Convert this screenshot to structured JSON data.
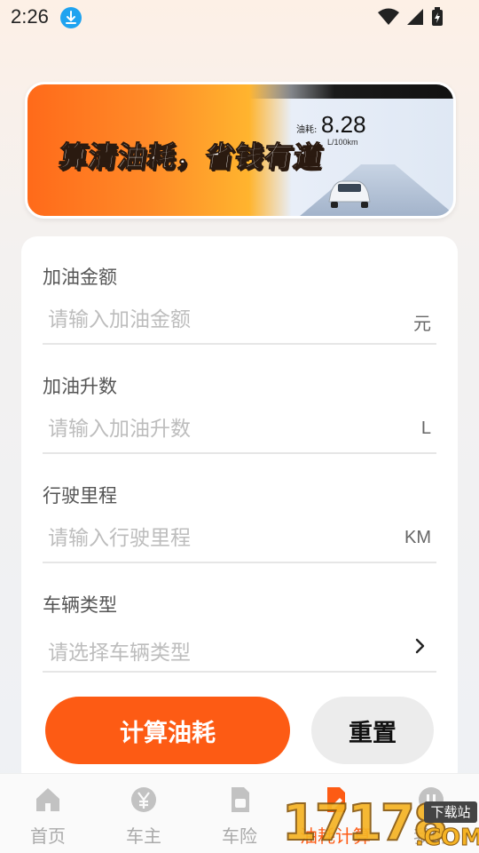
{
  "status_bar": {
    "time": "2:26"
  },
  "banner": {
    "slogan": "算清油耗，省钱有道",
    "fuel_label": "油耗:",
    "fuel_value": "8.28",
    "fuel_unit": "L/100km"
  },
  "form": {
    "fields": [
      {
        "label": "加油金额",
        "placeholder": "请输入加油金额",
        "unit": "元"
      },
      {
        "label": "加油升数",
        "placeholder": "请输入加油升数",
        "unit": "L"
      },
      {
        "label": "行驶里程",
        "placeholder": "请输入行驶里程",
        "unit": "KM"
      },
      {
        "label": "车辆类型",
        "placeholder": "请选择车辆类型"
      }
    ],
    "calculate_label": "计算油耗",
    "reset_label": "重置"
  },
  "nav": {
    "items": [
      {
        "label": "首页",
        "icon": "home-icon"
      },
      {
        "label": "车主",
        "icon": "yuan-coin-icon"
      },
      {
        "label": "车险",
        "icon": "insurance-doc-icon"
      },
      {
        "label": "油耗计算",
        "icon": "fuel-edit-icon",
        "active": true
      },
      {
        "label": "我的",
        "icon": "profile-icon"
      }
    ]
  },
  "watermark": {
    "digits": "17178",
    "badge": "下载站",
    "suffix": ".COM"
  },
  "colors": {
    "accent": "#fd5b14",
    "nav_inactive": "#aaaaaa",
    "placeholder": "#bdbdbd"
  }
}
